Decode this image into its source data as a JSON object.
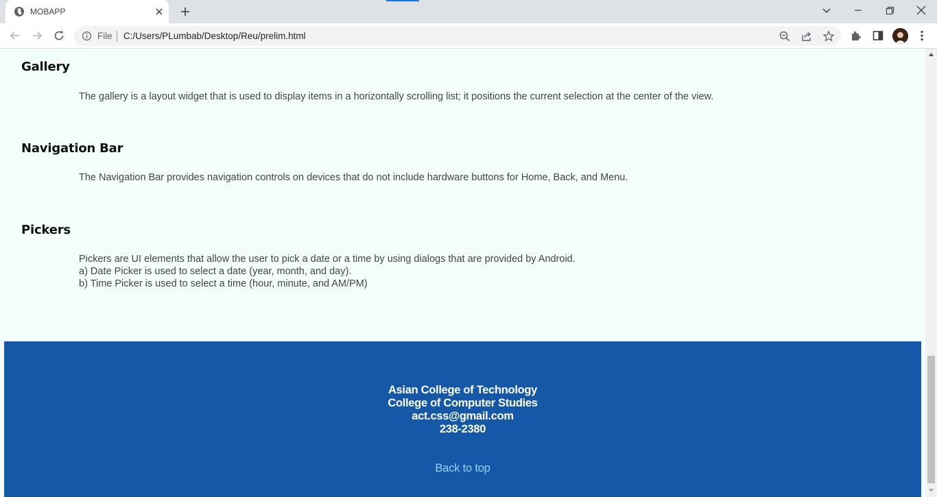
{
  "tab": {
    "title": "MOBAPP"
  },
  "omnibox": {
    "scheme_label": "File",
    "url": "C:/Users/PLumbab/Desktop/Reu/prelim.html"
  },
  "sections": [
    {
      "title": "Gallery",
      "lines": [
        "The gallery is a layout widget that is used to display items in a horizontally scrolling list; it positions the current selection at the center of the view."
      ]
    },
    {
      "title": "Navigation Bar",
      "lines": [
        "The Navigation Bar provides navigation controls on devices that do not include hardware buttons for Home, Back, and Menu."
      ]
    },
    {
      "title": "Pickers",
      "lines": [
        "Pickers are UI elements that allow the user to pick a date or a time by using dialogs that are provided by Android.",
        "a) Date Picker is used to select a date (year, month, and day).",
        "b) Time Picker is used to select a time (hour, minute, and AM/PM)"
      ]
    }
  ],
  "footer": {
    "lines": [
      "Asian College of Technology",
      "College of Computer Studies",
      "act.css@gmail.com",
      "238-2380"
    ],
    "back_to_top": "Back to top"
  },
  "icons": {
    "favicon": "globe-icon",
    "close": "close-icon",
    "new_tab": "plus-icon",
    "tab_search": "chevron-down-icon",
    "minimize": "minimize-icon",
    "restore": "restore-icon",
    "window_close": "close-icon",
    "back": "arrow-left-icon",
    "forward": "arrow-right-icon",
    "reload": "reload-icon",
    "info": "info-icon",
    "zoom": "zoom-out-icon",
    "share": "share-icon",
    "bookmark": "star-icon",
    "extensions": "puzzle-icon",
    "side_panel": "side-panel-icon",
    "profile": "avatar",
    "menu": "kebab-menu-icon"
  },
  "colors": {
    "page_bg": "#f2fdfc",
    "footer_bg": "#1558a7",
    "link": "#9ad2ff",
    "chrome_accent": "#1a73e8"
  }
}
